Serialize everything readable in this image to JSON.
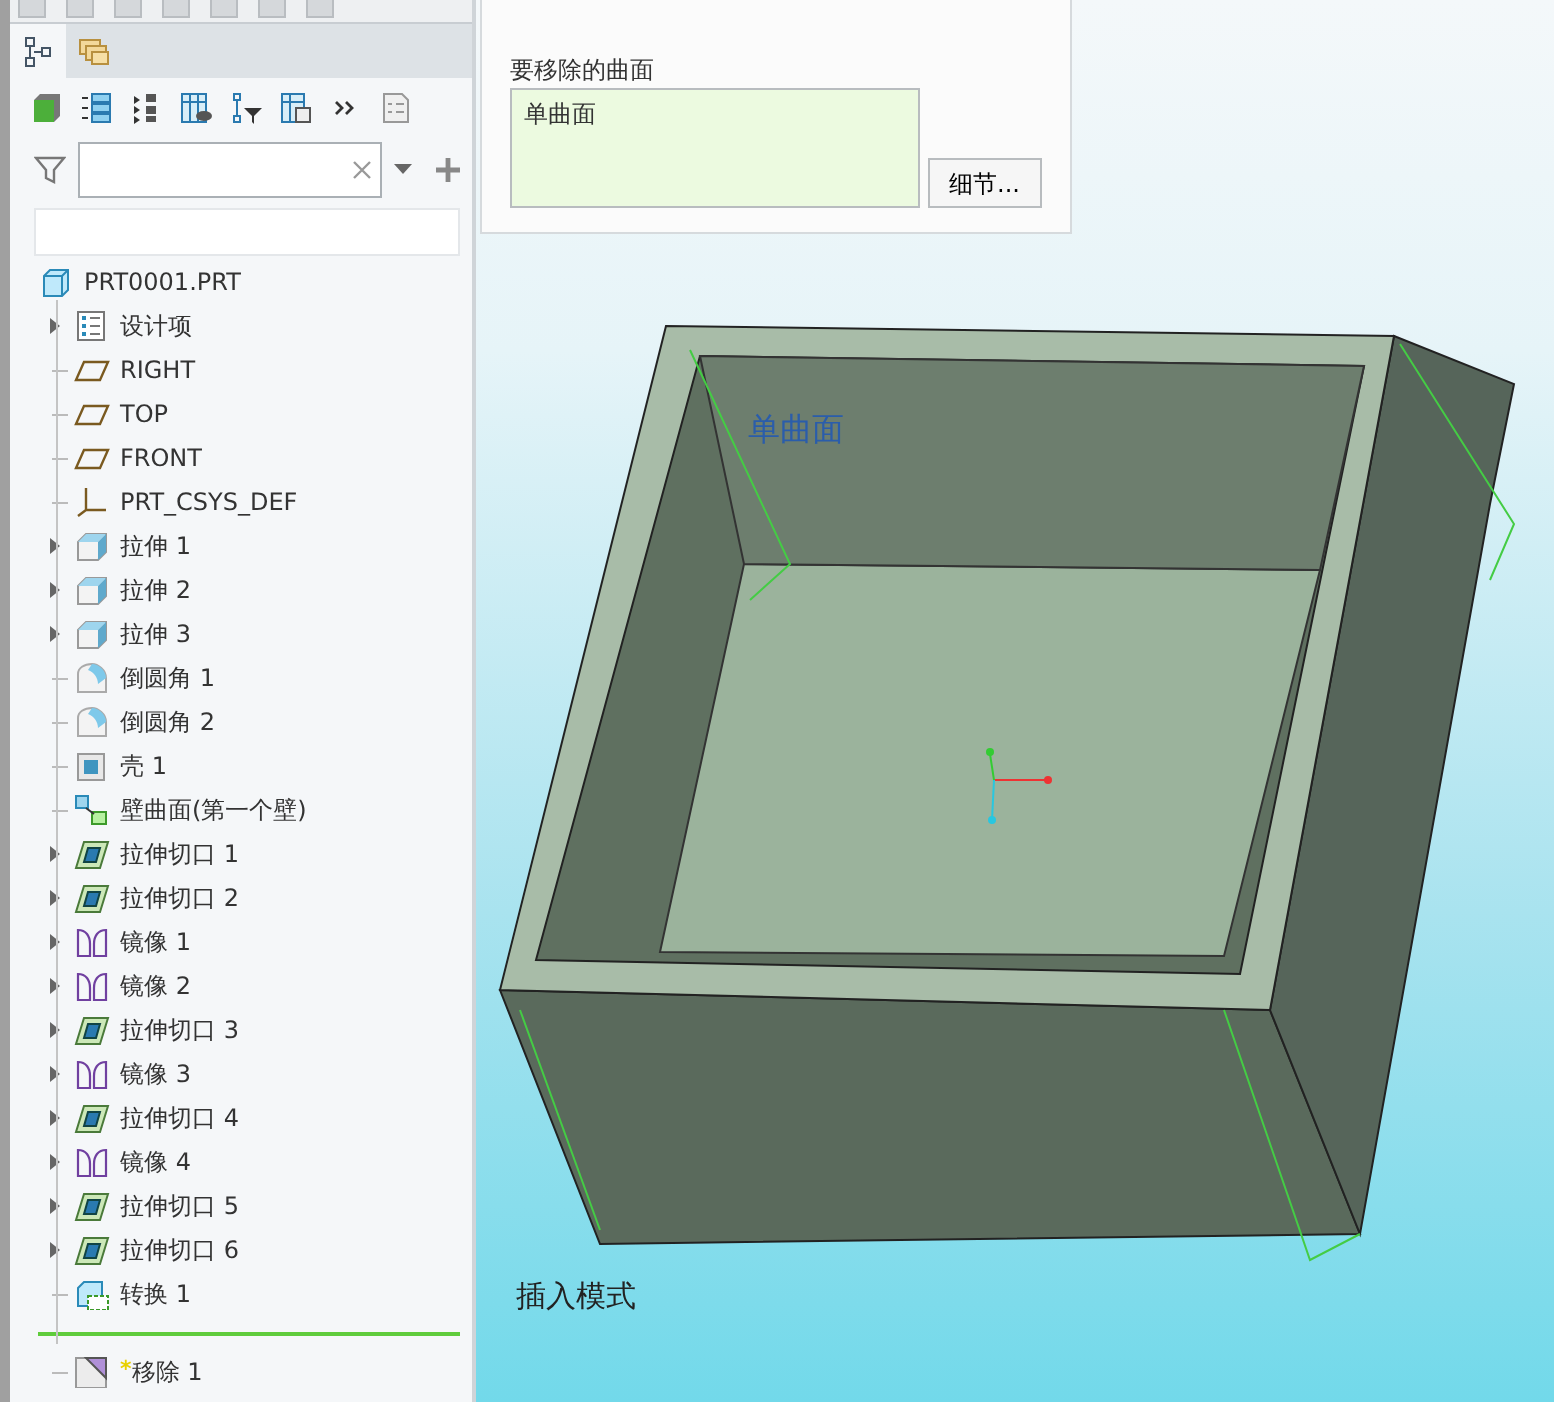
{
  "model_tree_tabs": [
    {
      "kind": "tree",
      "selected": true
    },
    {
      "kind": "folders",
      "selected": false
    }
  ],
  "tree": {
    "root": "PRT0001.PRT",
    "items": [
      {
        "label": "设计项",
        "kind": "design-items",
        "has_children": true
      },
      {
        "label": "RIGHT",
        "kind": "plane",
        "has_children": false
      },
      {
        "label": "TOP",
        "kind": "plane",
        "has_children": false
      },
      {
        "label": "FRONT",
        "kind": "plane",
        "has_children": false
      },
      {
        "label": "PRT_CSYS_DEF",
        "kind": "csys",
        "has_children": false
      },
      {
        "label": "拉伸 1",
        "kind": "extrude",
        "has_children": true
      },
      {
        "label": "拉伸 2",
        "kind": "extrude",
        "has_children": true
      },
      {
        "label": "拉伸 3",
        "kind": "extrude",
        "has_children": true
      },
      {
        "label": "倒圆角 1",
        "kind": "round",
        "has_children": false
      },
      {
        "label": "倒圆角 2",
        "kind": "round",
        "has_children": false
      },
      {
        "label": "壳 1",
        "kind": "shell",
        "has_children": false
      },
      {
        "label": "壁曲面(第一个壁)",
        "kind": "wall",
        "has_children": false
      },
      {
        "label": "拉伸切口 1",
        "kind": "cut",
        "has_children": true
      },
      {
        "label": "拉伸切口 2",
        "kind": "cut",
        "has_children": true
      },
      {
        "label": "镜像 1",
        "kind": "mirror",
        "has_children": true
      },
      {
        "label": "镜像 2",
        "kind": "mirror",
        "has_children": true
      },
      {
        "label": "拉伸切口 3",
        "kind": "cut",
        "has_children": true
      },
      {
        "label": "镜像 3",
        "kind": "mirror",
        "has_children": true
      },
      {
        "label": "拉伸切口 4",
        "kind": "cut",
        "has_children": true
      },
      {
        "label": "镜像 4",
        "kind": "mirror",
        "has_children": true
      },
      {
        "label": "拉伸切口 5",
        "kind": "cut",
        "has_children": true
      },
      {
        "label": "拉伸切口 6",
        "kind": "cut",
        "has_children": true
      },
      {
        "label": "转换 1",
        "kind": "transform",
        "has_children": false
      }
    ],
    "insert_item": {
      "flag": "*",
      "label": "移除 1",
      "kind": "remove"
    }
  },
  "remove_panel": {
    "label": "要移除的曲面",
    "collector": "单曲面",
    "button": "细节..."
  },
  "viewport": {
    "surface_label": "单曲面",
    "mode": "插入模式"
  }
}
